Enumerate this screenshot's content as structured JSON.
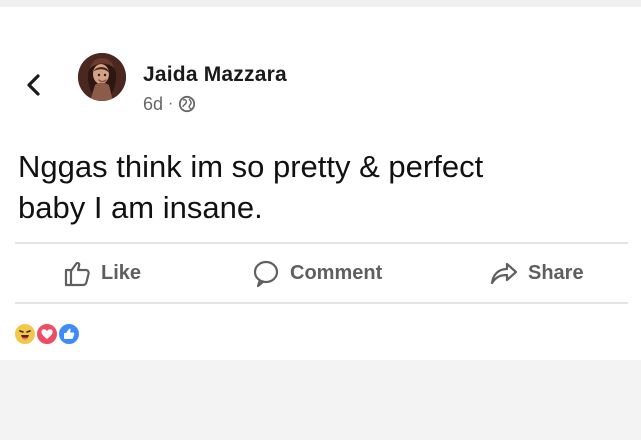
{
  "post": {
    "author_name": "Jaida Mazzara",
    "time_ago": "6d",
    "meta_separator": "·",
    "text": "Nggas think im so pretty & perfect\nbaby I am insane."
  },
  "icons": {
    "back": "chevron-left-icon",
    "audience": "globe-icon",
    "like": "thumb-up-icon",
    "comment": "speech-bubble-icon",
    "share": "share-arrow-icon",
    "reactions": [
      "haha-reaction-icon",
      "love-reaction-icon",
      "like-reaction-icon"
    ]
  },
  "actions": {
    "like_label": "Like",
    "comment_label": "Comment",
    "share_label": "Share"
  },
  "colors": {
    "background": "#f3f3f3",
    "card": "#ffffff",
    "text": "#111111",
    "secondary_text": "#666666",
    "divider": "#e4e4e4",
    "haha": "#f2c84a",
    "love": "#f14c66",
    "like": "#3d8bfd"
  }
}
